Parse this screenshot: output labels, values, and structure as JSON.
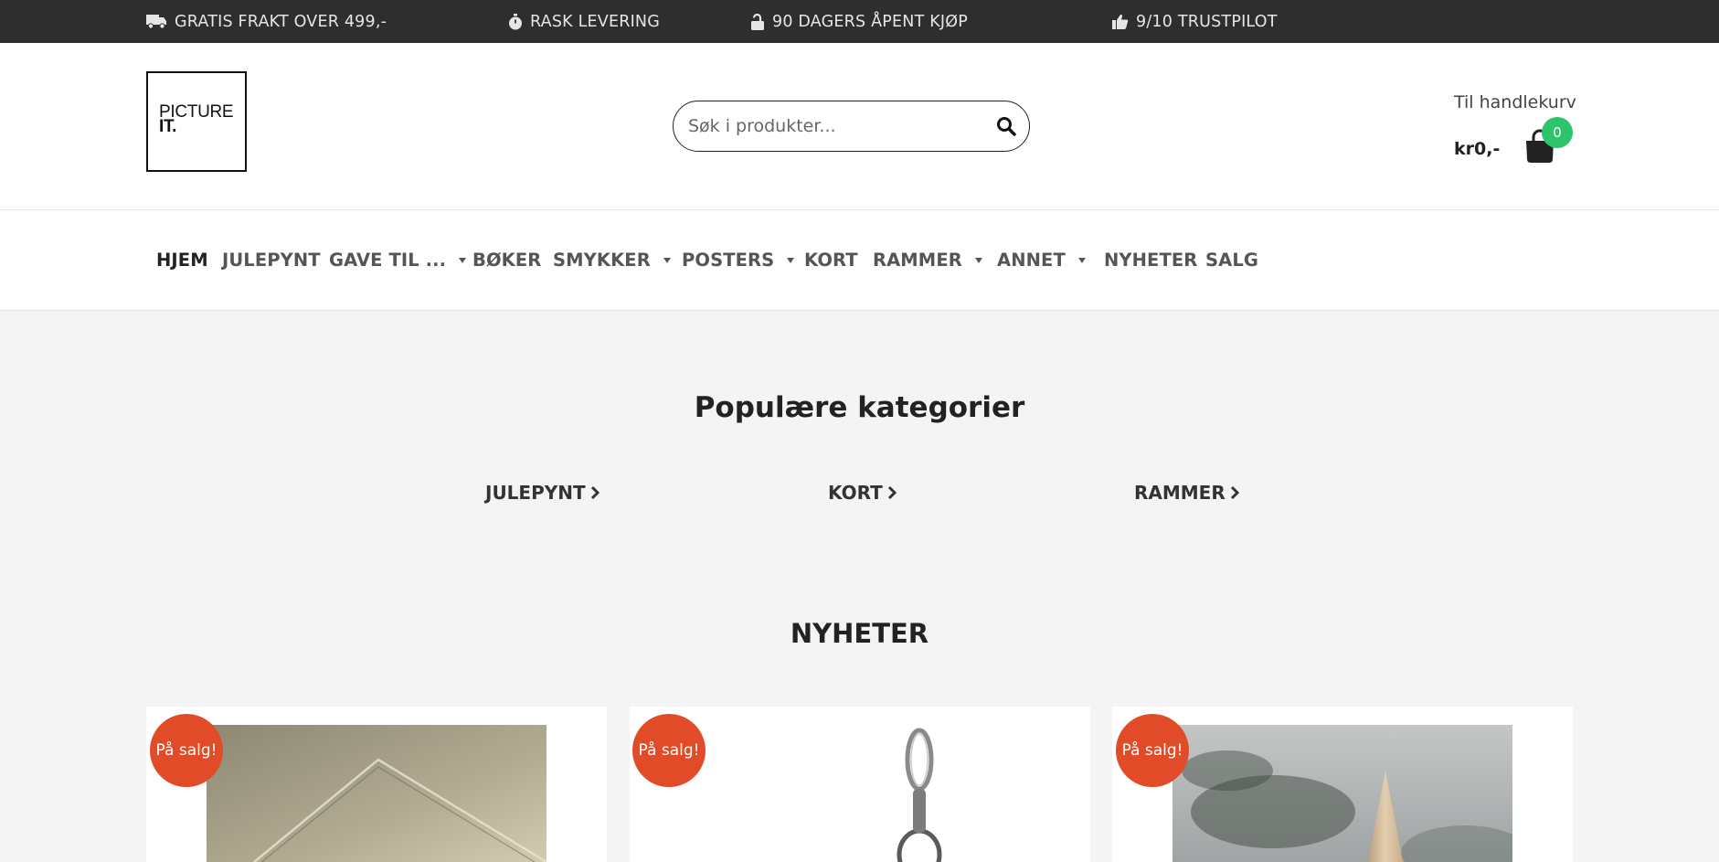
{
  "topbar": {
    "items": [
      {
        "icon": "truck-icon",
        "label": "GRATIS FRAKT OVER 499,-"
      },
      {
        "icon": "stopwatch-icon",
        "label": "RASK LEVERING"
      },
      {
        "icon": "unlock-icon",
        "label": "90 DAGERS ÅPENT KJØP"
      },
      {
        "icon": "thumbs-up-icon",
        "label": "9/10 TRUSTPILOT"
      }
    ]
  },
  "header": {
    "logo_line1": "PICTURE",
    "logo_line2": "IT.",
    "search_placeholder": "Søk i produkter...",
    "cart_label": "Til handlekurv",
    "cart_total": "kr0,-",
    "cart_count": "0"
  },
  "nav": {
    "items": [
      {
        "label": "HJEM"
      },
      {
        "label": "JULEPYNT"
      },
      {
        "label": "GAVE TIL ..."
      },
      {
        "label": "BØKER"
      },
      {
        "label": "SMYKKER"
      },
      {
        "label": "POSTERS"
      },
      {
        "label": "KORT"
      },
      {
        "label": "RAMMER"
      },
      {
        "label": "ANNET"
      },
      {
        "label": "NYHETER"
      },
      {
        "label": "SALG"
      }
    ]
  },
  "popular": {
    "title": "Populære kategorier",
    "categories": [
      {
        "label": "JULEPYNT"
      },
      {
        "label": "KORT"
      },
      {
        "label": "RAMMER"
      }
    ]
  },
  "news": {
    "title": "NYHETER",
    "sale_label": "På salg!"
  },
  "colors": {
    "topbar_bg": "#2e2e2e",
    "sale_badge": "#e14b27",
    "cart_badge": "#2ec46b",
    "page_bg": "#f4f4f4"
  }
}
